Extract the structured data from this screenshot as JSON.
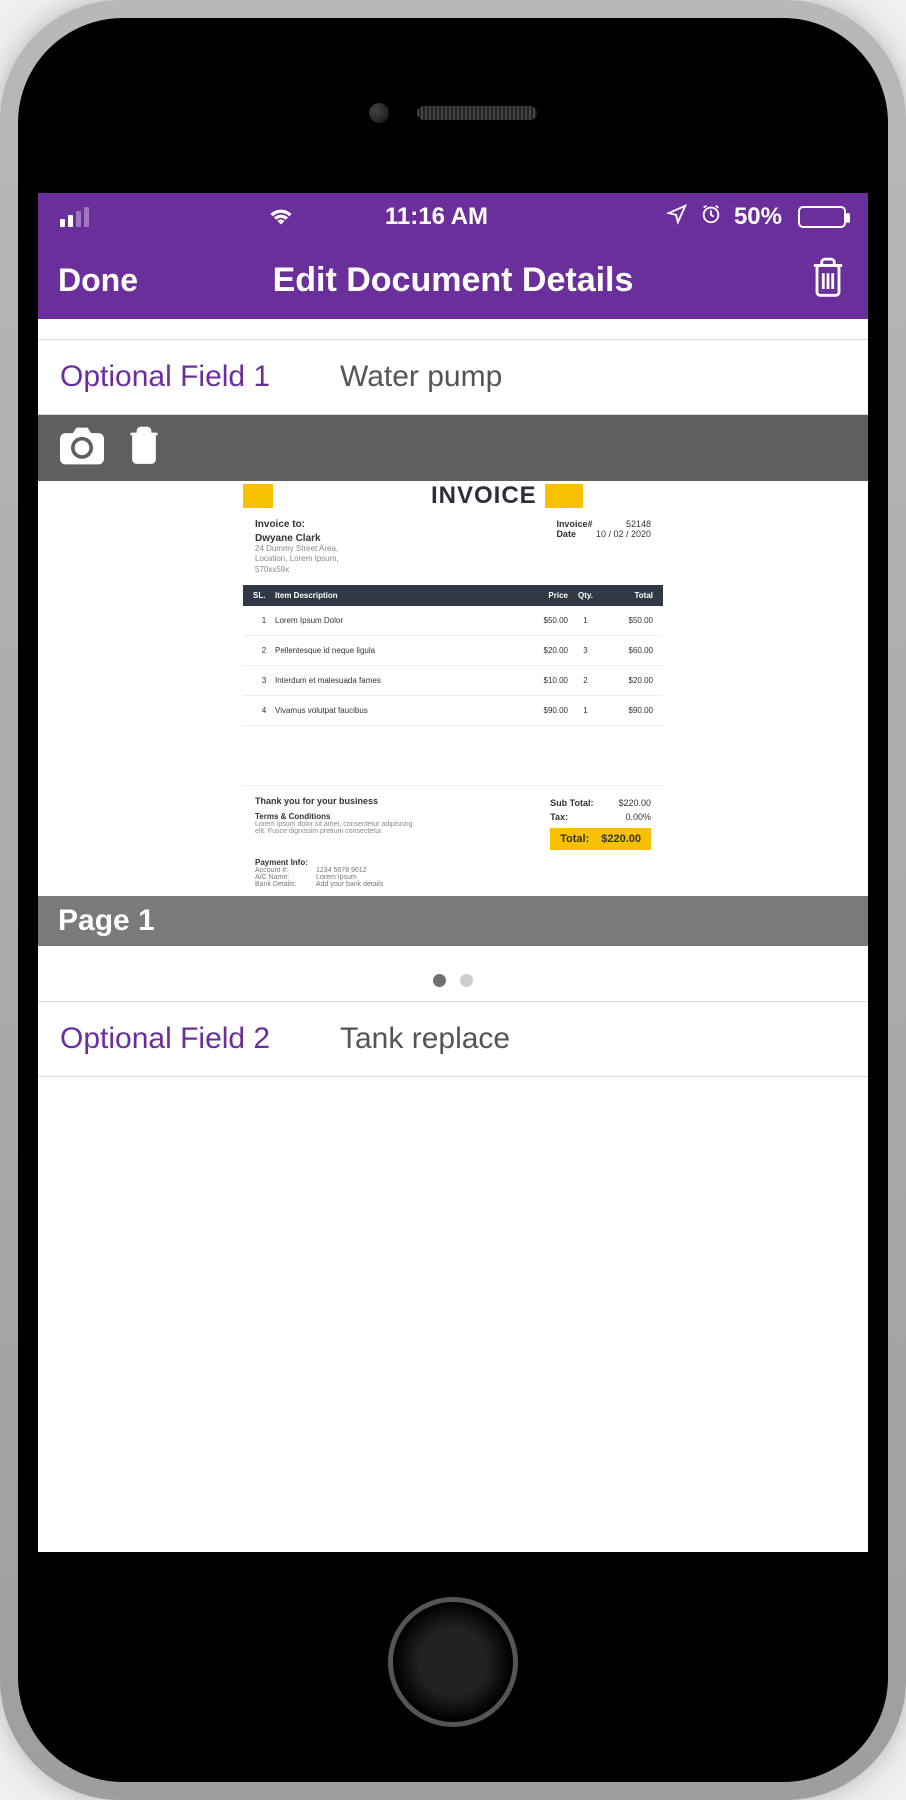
{
  "status": {
    "time": "11:16 AM",
    "battery_percent": "50%"
  },
  "nav": {
    "done_label": "Done",
    "title": "Edit Document Details"
  },
  "fields": [
    {
      "label": "Optional Field 1",
      "value": "Water pump"
    },
    {
      "label": "Optional Field 2",
      "value": "Tank replace"
    }
  ],
  "preview": {
    "page_label": "Page 1",
    "current_page": 1,
    "total_pages": 2
  },
  "invoice": {
    "title": "INVOICE",
    "to_label": "Invoice to:",
    "to_name": "Dwyane Clark",
    "to_addr": "24 Dummy Street Area,\nLocation, Lorem Ipsum,\n570xx59x",
    "number_label": "Invoice#",
    "number": "52148",
    "date_label": "Date",
    "date": "10 / 02 / 2020",
    "columns": [
      "SL.",
      "Item Description",
      "Price",
      "Qty.",
      "Total"
    ],
    "rows": [
      {
        "sl": "1",
        "desc": "Lorem Ipsum Dolor",
        "price": "$50.00",
        "qty": "1",
        "total": "$50.00"
      },
      {
        "sl": "2",
        "desc": "Pellentesque id neque ligula",
        "price": "$20.00",
        "qty": "3",
        "total": "$60.00"
      },
      {
        "sl": "3",
        "desc": "Interdum et malesuada fames",
        "price": "$10.00",
        "qty": "2",
        "total": "$20.00"
      },
      {
        "sl": "4",
        "desc": "Vivamus volutpat faucibus",
        "price": "$90.00",
        "qty": "1",
        "total": "$90.00"
      }
    ],
    "thank_you": "Thank you for your business",
    "terms_label": "Terms & Conditions",
    "terms_text": "Lorem ipsum dolor sit amet, consectetur adipiscing elit. Fusce dignissim pretium consectetur.",
    "subtotal_label": "Sub Total:",
    "subtotal": "$220.00",
    "tax_label": "Tax:",
    "tax": "0.00%",
    "total_label": "Total:",
    "total": "$220.00",
    "payment_label": "Payment Info:",
    "payment": [
      {
        "k": "Account #:",
        "v": "1234 5678 9012"
      },
      {
        "k": "A/C Name:",
        "v": "Lorem Ipsum"
      },
      {
        "k": "Bank Details:",
        "v": "Add your bank details"
      }
    ]
  }
}
